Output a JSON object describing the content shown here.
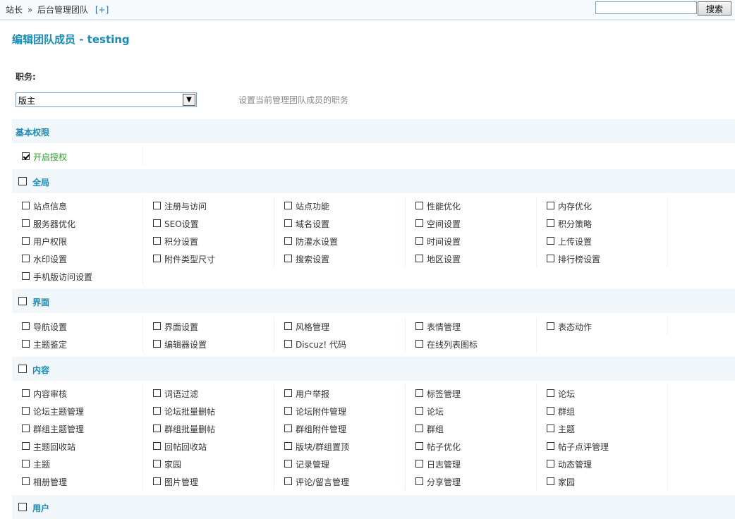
{
  "topbar": {
    "crumb_root": "站长",
    "crumb_sep": "»",
    "crumb_current": "后台管理团队",
    "crumb_add": "[+]",
    "search_value": "",
    "search_button": "搜索"
  },
  "page_title": "编辑团队成员 - testing",
  "role": {
    "label": "职务:",
    "selected": "版主",
    "tip": "设置当前管理团队成员的职务"
  },
  "sections": {
    "basic": {
      "title": "基本权限",
      "enable_auth": "开启授权",
      "enable_checked": true
    },
    "global": {
      "title": "全局",
      "items": [
        "站点信息",
        "注册与访问",
        "站点功能",
        "性能优化",
        "内存优化",
        "服务器优化",
        "SEO设置",
        "域名设置",
        "空间设置",
        "积分策略",
        "用户权限",
        "积分设置",
        "防灌水设置",
        "时间设置",
        "上传设置",
        "水印设置",
        "附件类型尺寸",
        "搜索设置",
        "地区设置",
        "排行榜设置",
        "手机版访问设置"
      ]
    },
    "ui": {
      "title": "界面",
      "items": [
        "导航设置",
        "界面设置",
        "风格管理",
        "表情管理",
        "表态动作",
        "主题鉴定",
        "编辑器设置",
        "Discuz! 代码",
        "在线列表图标"
      ]
    },
    "content": {
      "title": "内容",
      "items": [
        "内容审核",
        "词语过滤",
        "用户举报",
        "标签管理",
        "论坛",
        "论坛主题管理",
        "论坛批量删帖",
        "论坛附件管理",
        "论坛",
        "群组",
        "群组主题管理",
        "群组批量删帖",
        "群组附件管理",
        "群组",
        "主题",
        "主题回收站",
        "回帖回收站",
        "版块/群组置顶",
        "帖子优化",
        "帖子点评管理",
        "主题",
        "家园",
        "记录管理",
        "日志管理",
        "动态管理",
        "相册管理",
        "图片管理",
        "评论/留言管理",
        "分享管理",
        "家园"
      ]
    },
    "users": {
      "title": "用户"
    }
  }
}
